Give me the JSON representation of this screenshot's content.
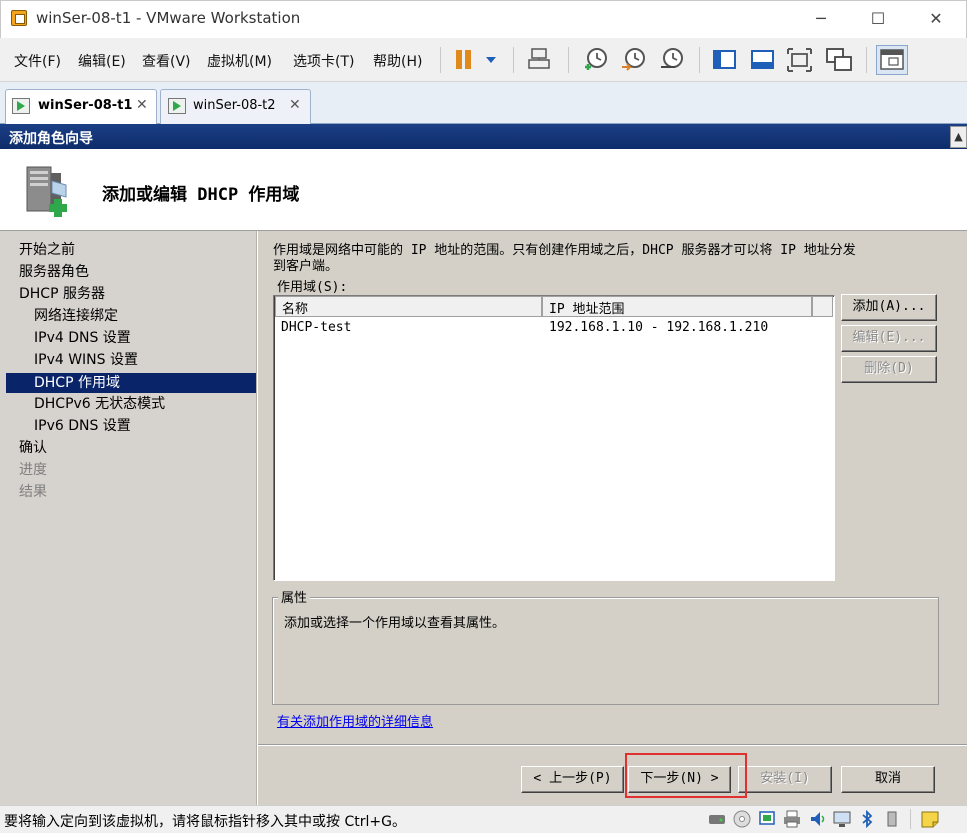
{
  "window": {
    "title": "winSer-08-t1 - VMware Workstation",
    "controls": {
      "minimize": "─",
      "maximize": "☐",
      "close": "✕"
    }
  },
  "menu": [
    "文件(F)",
    "编辑(E)",
    "查看(V)",
    "虚拟机(M)",
    "选项卡(T)",
    "帮助(H)"
  ],
  "tabs": [
    {
      "label": "winSer-08-t1",
      "close": "✕",
      "active": true
    },
    {
      "label": "winSer-08-t2",
      "close": "✕",
      "active": false
    }
  ],
  "wizard": {
    "window_title": "添加角色向导",
    "page_title": "添加或编辑 DHCP 作用域",
    "nav": [
      {
        "label": "开始之前",
        "state": "normal"
      },
      {
        "label": "服务器角色",
        "state": "normal"
      },
      {
        "label": "DHCP 服务器",
        "state": "normal"
      },
      {
        "label": "网络连接绑定",
        "state": "sub"
      },
      {
        "label": "IPv4 DNS 设置",
        "state": "sub"
      },
      {
        "label": "IPv4 WINS 设置",
        "state": "sub"
      },
      {
        "label": "DHCP 作用域",
        "state": "active"
      },
      {
        "label": "DHCPv6 无状态模式",
        "state": "sub"
      },
      {
        "label": "IPv6 DNS 设置",
        "state": "sub"
      },
      {
        "label": "确认",
        "state": "normal"
      },
      {
        "label": "进度",
        "state": "disabled"
      },
      {
        "label": "结果",
        "state": "disabled"
      }
    ],
    "description_line1": "作用域是网络中可能的 IP 地址的范围。只有创建作用域之后，DHCP 服务器才可以将 IP 地址分发",
    "description_line2": "到客户端。",
    "scope_label": "作用域(S):",
    "columns": [
      "名称",
      "IP 地址范围"
    ],
    "rows": [
      {
        "name": "DHCP-test",
        "range": "192.168.1.10 - 192.168.1.210"
      }
    ],
    "side_buttons": {
      "add": "添加(A)...",
      "edit": "编辑(E)...",
      "delete": "删除(D)"
    },
    "properties_title": "属性",
    "properties_text": "添加或选择一个作用域以查看其属性。",
    "help_link": "有关添加作用域的详细信息",
    "footer_buttons": {
      "back": "< 上一步(P)",
      "next": "下一步(N) >",
      "install": "安装(I)",
      "cancel": "取消"
    }
  },
  "status": {
    "text": "要将输入定向到该虚拟机，请将鼠标指针移入其中或按 Ctrl+G。"
  },
  "colors": {
    "wizard_title_bg": "#0e2c6a",
    "nav_active_bg": "#0a246a",
    "highlight": "#e03030",
    "link": "#0000ee"
  }
}
